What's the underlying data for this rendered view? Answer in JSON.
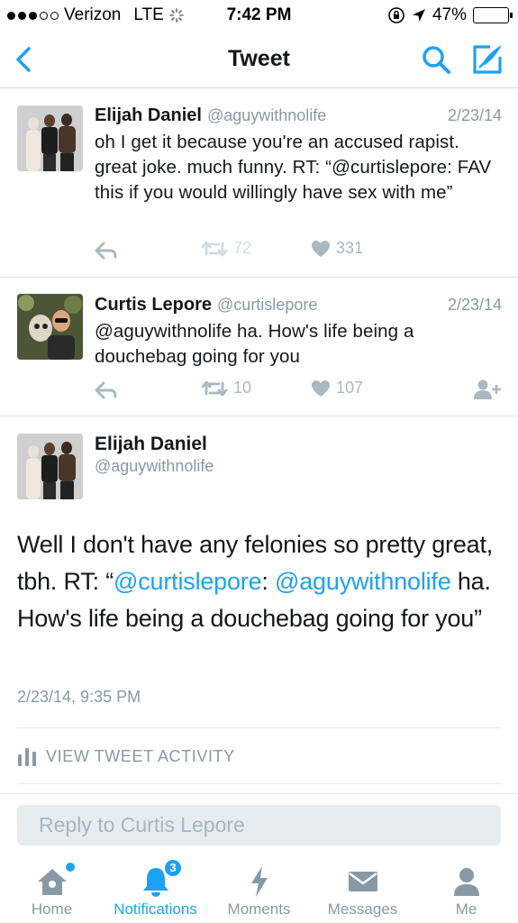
{
  "status_bar": {
    "carrier": "Verizon",
    "network": "LTE",
    "time": "7:42 PM",
    "battery": "47%",
    "battery_level": 0.47
  },
  "nav": {
    "title": "Tweet",
    "back_icon": "chevron-left-icon",
    "search_icon": "search-icon",
    "compose_icon": "compose-icon"
  },
  "tweets": [
    {
      "name": "Elijah Daniel",
      "handle": "@aguywithnolife",
      "date": "2/23/14",
      "text": "oh I get it because you're an accused rapist. great joke. much funny. RT:  “@curtislepore: FAV this if you would willingly have sex with me”",
      "retweets": "72",
      "likes": "331"
    },
    {
      "name": "Curtis Lepore",
      "handle": "@curtislepore",
      "date": "2/23/14",
      "text": "@aguywithnolife ha. How's life being a douchebag going for you",
      "retweets": "10",
      "likes": "107"
    }
  ],
  "detail": {
    "name": "Elijah Daniel",
    "handle": "@aguywithnolife",
    "text_part1": "Well I don't have any felonies so pretty great, tbh. RT: “",
    "mention1": "@curtislepore",
    "text_part2": ": ",
    "mention2": "@aguywithnolife",
    "text_part3": " ha. How's life being a douchebag going for you”",
    "timestamp": "2/23/14, 9:35 PM",
    "activity_label": "VIEW TWEET ACTIVITY"
  },
  "reply": {
    "placeholder": "Reply to Curtis Lepore"
  },
  "tabs": [
    {
      "label": "Home",
      "icon": "home-icon"
    },
    {
      "label": "Notifications",
      "icon": "bell-icon",
      "badge": "3"
    },
    {
      "label": "Moments",
      "icon": "lightning-icon"
    },
    {
      "label": "Messages",
      "icon": "envelope-icon"
    },
    {
      "label": "Me",
      "icon": "person-icon"
    }
  ],
  "colors": {
    "accent": "#1da1f2",
    "secondary_text": "#8899a6",
    "primary_text": "#14171a"
  }
}
